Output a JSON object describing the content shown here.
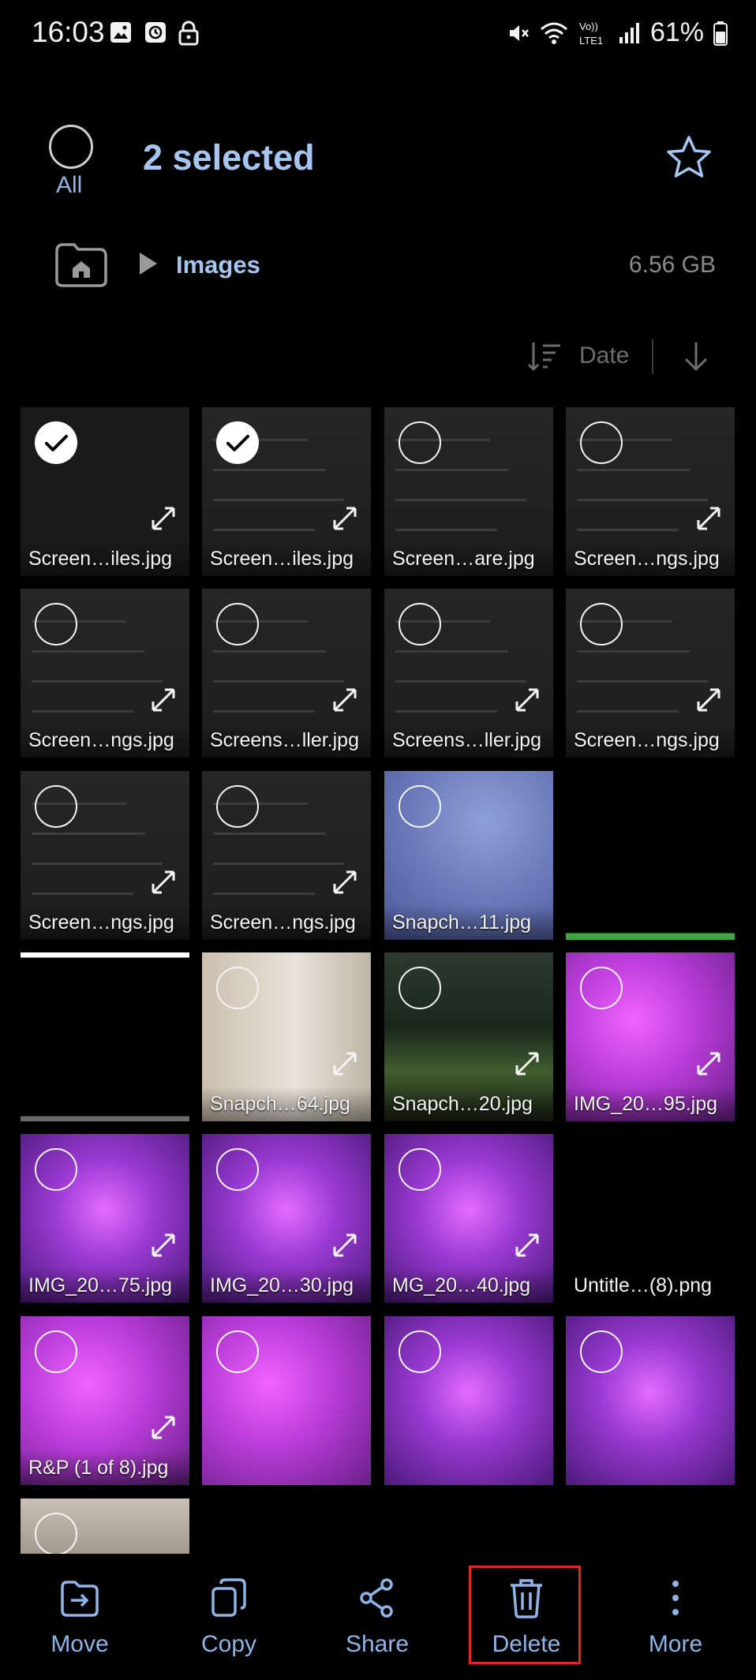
{
  "status_bar": {
    "time": "16:03",
    "left_icons": [
      "image-icon",
      "alarm-icon",
      "lock-icon"
    ],
    "right_icons": [
      "mute-icon",
      "wifi-icon",
      "volte-icon",
      "signal-icon"
    ],
    "network_label": "Vo)) LTE1",
    "battery": "61%"
  },
  "selection": {
    "all_label": "All",
    "count_label": "2 selected"
  },
  "breadcrumb": {
    "folder": "Images",
    "size": "6.56 GB"
  },
  "sort": {
    "label": "Date"
  },
  "tiles": [
    {
      "name": "Screen…iles.jpg",
      "selected": true,
      "theme": "th-dark",
      "expand": true
    },
    {
      "name": "Screen…iles.jpg",
      "selected": true,
      "theme": "th-ui",
      "expand": true
    },
    {
      "name": "Screen…are.jpg",
      "selected": false,
      "theme": "th-ui",
      "expand": false
    },
    {
      "name": "Screen…ngs.jpg",
      "selected": false,
      "theme": "th-ui",
      "expand": true
    },
    {
      "name": "Screen…ngs.jpg",
      "selected": false,
      "theme": "th-ui",
      "expand": true
    },
    {
      "name": "Screens…ller.jpg",
      "selected": false,
      "theme": "th-ui",
      "expand": true
    },
    {
      "name": "Screens…ller.jpg",
      "selected": false,
      "theme": "th-ui",
      "expand": true
    },
    {
      "name": "Screen…ngs.jpg",
      "selected": false,
      "theme": "th-ui",
      "expand": true
    },
    {
      "name": "Screen…ngs.jpg",
      "selected": false,
      "theme": "th-ui",
      "expand": true
    },
    {
      "name": "Screen…ngs.jpg",
      "selected": false,
      "theme": "th-ui",
      "expand": true
    },
    {
      "name": "Snapch…11.jpg",
      "selected": false,
      "theme": "th-sky",
      "expand": false
    },
    {
      "name": "",
      "selected": null,
      "theme": "th-green",
      "expand": false
    },
    {
      "name": "",
      "selected": null,
      "theme": "th-white",
      "expand": false
    },
    {
      "name": "Snapch…64.jpg",
      "selected": false,
      "theme": "th-room",
      "expand": true
    },
    {
      "name": "Snapch…20.jpg",
      "selected": false,
      "theme": "th-night",
      "expand": true
    },
    {
      "name": "IMG_20…95.jpg",
      "selected": false,
      "theme": "th-pink",
      "expand": true
    },
    {
      "name": "IMG_20…75.jpg",
      "selected": false,
      "theme": "th-purple",
      "expand": true
    },
    {
      "name": "IMG_20…30.jpg",
      "selected": false,
      "theme": "th-purple",
      "expand": true
    },
    {
      "name": "MG_20…40.jpg",
      "selected": false,
      "theme": "th-purple",
      "expand": true
    },
    {
      "name": "Untitle…(8).png",
      "selected": null,
      "theme": "th-black",
      "expand": false
    },
    {
      "name": "R&P (1 of 8).jpg",
      "selected": false,
      "theme": "th-pink",
      "expand": true
    },
    {
      "name": "",
      "selected": false,
      "theme": "th-pink",
      "expand": false
    },
    {
      "name": "",
      "selected": false,
      "theme": "th-purple",
      "expand": false
    },
    {
      "name": "",
      "selected": false,
      "theme": "th-purple",
      "expand": false
    },
    {
      "name": "",
      "selected": false,
      "theme": "th-beige",
      "expand": false
    }
  ],
  "actions": [
    {
      "label": "Move",
      "icon": "move-icon"
    },
    {
      "label": "Copy",
      "icon": "copy-icon"
    },
    {
      "label": "Share",
      "icon": "share-icon"
    },
    {
      "label": "Delete",
      "icon": "trash-icon"
    },
    {
      "label": "More",
      "icon": "more-vertical-icon"
    }
  ],
  "colors": {
    "accent": "#a6c6f2",
    "label": "#8fb4e8",
    "highlight": "#e0262b"
  }
}
